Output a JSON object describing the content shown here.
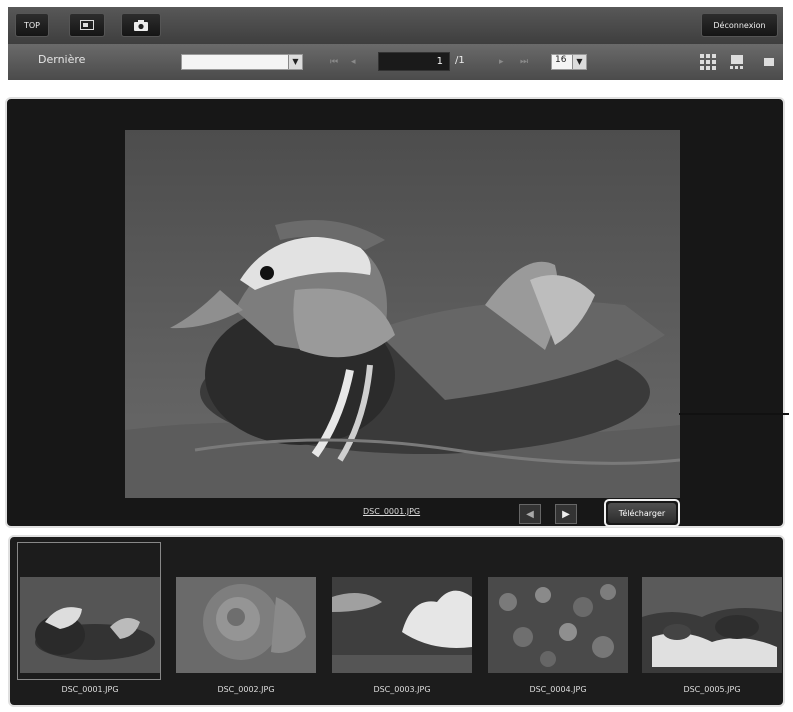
{
  "toolbar": {
    "top_label": "TOP",
    "logout_label": "Déconnexion"
  },
  "nav": {
    "sort_label": "Dernière",
    "date_select_value": "",
    "first_label": "⏮",
    "prev_label": "◂",
    "page_value": "1",
    "page_total": "/1",
    "next_label": "▸",
    "last_label": "⏭",
    "per_page_value": "16"
  },
  "viewer": {
    "filename": "DSC_0001.JPG",
    "prev_arrow": "◀",
    "next_arrow": "▶",
    "download_label": "Télécharger"
  },
  "thumbnails": [
    {
      "label": "DSC_0001.JPG",
      "subject": "duck"
    },
    {
      "label": "DSC_0002.JPG",
      "subject": "rose"
    },
    {
      "label": "DSC_0003.JPG",
      "subject": "clouds"
    },
    {
      "label": "DSC_0004.JPG",
      "subject": "flowers"
    },
    {
      "label": "DSC_0005.JPG",
      "subject": "stream"
    }
  ],
  "colors": {
    "bar_dark": "#3e3e3e",
    "viewer_bg": "#171717",
    "frame_border": "#e0e0e0"
  }
}
